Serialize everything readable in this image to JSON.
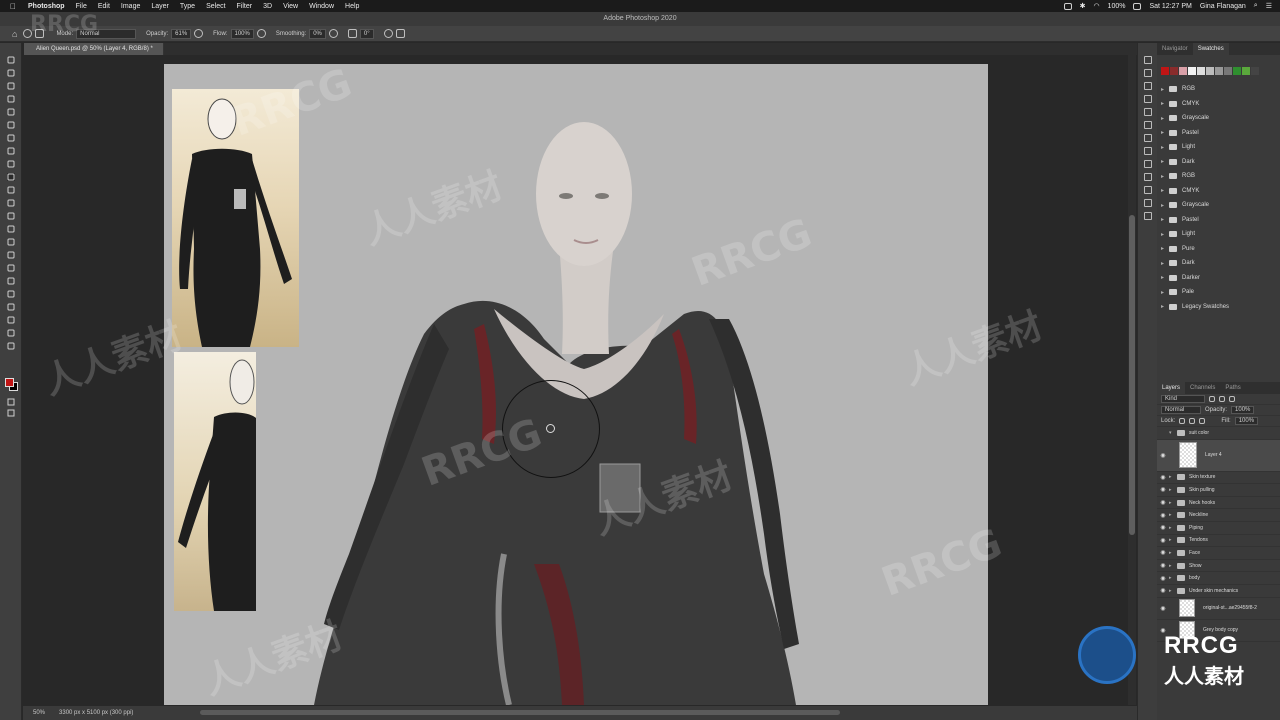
{
  "menubar": {
    "app": "Photoshop",
    "items": [
      "File",
      "Edit",
      "Image",
      "Layer",
      "Type",
      "Select",
      "Filter",
      "3D",
      "View",
      "Window",
      "Help"
    ],
    "battery": "100%",
    "clock": "Sat 12:27 PM",
    "user": "Gina Flanagan"
  },
  "titlebar": {
    "title": "Adobe Photoshop 2020"
  },
  "options": {
    "mode_label": "Mode:",
    "mode_value": "Normal",
    "opacity_label": "Opacity:",
    "opacity_value": "61%",
    "flow_label": "Flow:",
    "flow_value": "100%",
    "smoothing_label": "Smoothing:",
    "smoothing_value": "0%",
    "angle_value": "0°"
  },
  "document": {
    "tab_title": "Alien Queen.psd @ 50% (Layer 4, RGB/8) *",
    "zoom": "50%",
    "dimensions": "3300 px x 5100 px (300 ppi)"
  },
  "colors": {
    "foreground": "#c01515",
    "background": "#000000",
    "accent": "#2a73c4"
  },
  "swatches_panel": {
    "tabs": [
      "Navigator",
      "Swatches"
    ],
    "active_tab": "Swatches",
    "recent_colors": [
      "#c01515",
      "#8a2c2c",
      "#d9a0a8",
      "#f2f2f2",
      "#dddddd",
      "#bcbcbc",
      "#999999",
      "#777777",
      "#2f8f2f",
      "#5aa83c",
      "#444444"
    ],
    "groups": [
      "RGB",
      "CMYK",
      "Grayscale",
      "Pastel",
      "Light",
      "Dark",
      "RGB",
      "CMYK",
      "Grayscale",
      "Pastel",
      "Light",
      "Pure",
      "Dark",
      "Darker",
      "Pale",
      "Legacy Swatches"
    ]
  },
  "layers_panel": {
    "tabs": [
      "Layers",
      "Channels",
      "Paths"
    ],
    "active_tab": "Layers",
    "filter_value": "Kind",
    "blend_mode": "Normal",
    "opacity_label": "Opacity:",
    "opacity_value": "100%",
    "lock_label": "Lock:",
    "fill_label": "Fill:",
    "fill_value": "100%",
    "group_name": "suit color",
    "active_layer": "Layer 4",
    "folders": [
      "Skin texture",
      "Skin pulling",
      "Neck hooks",
      "Neckline",
      "Piping",
      "Tendons",
      "Face",
      "Show",
      "body",
      "Under skin mechanics"
    ],
    "bottom_layers": [
      "original-st...ae29455f8-2",
      "Grey body copy"
    ]
  },
  "watermark": {
    "brand": "RRCG",
    "cn": "人人素材"
  }
}
